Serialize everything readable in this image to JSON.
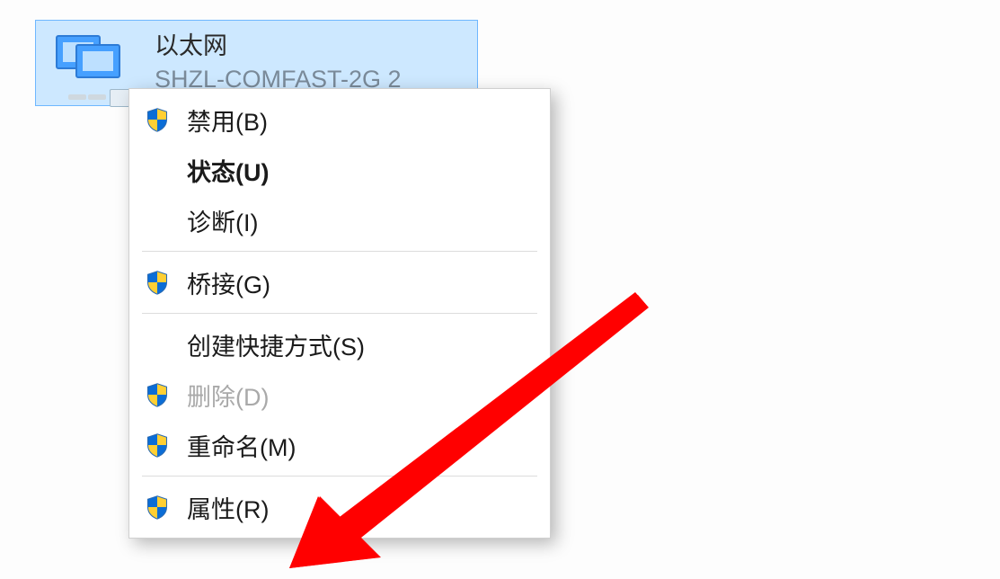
{
  "adapter": {
    "title": "以太网",
    "subtitle": "SHZL-COMFAST-2G 2"
  },
  "menu": {
    "items": {
      "disable": "禁用(B)",
      "status": "状态(U)",
      "diagnose": "诊断(I)",
      "bridge": "桥接(G)",
      "shortcut": "创建快捷方式(S)",
      "delete": "删除(D)",
      "rename": "重命名(M)",
      "properties": "属性(R)"
    }
  }
}
